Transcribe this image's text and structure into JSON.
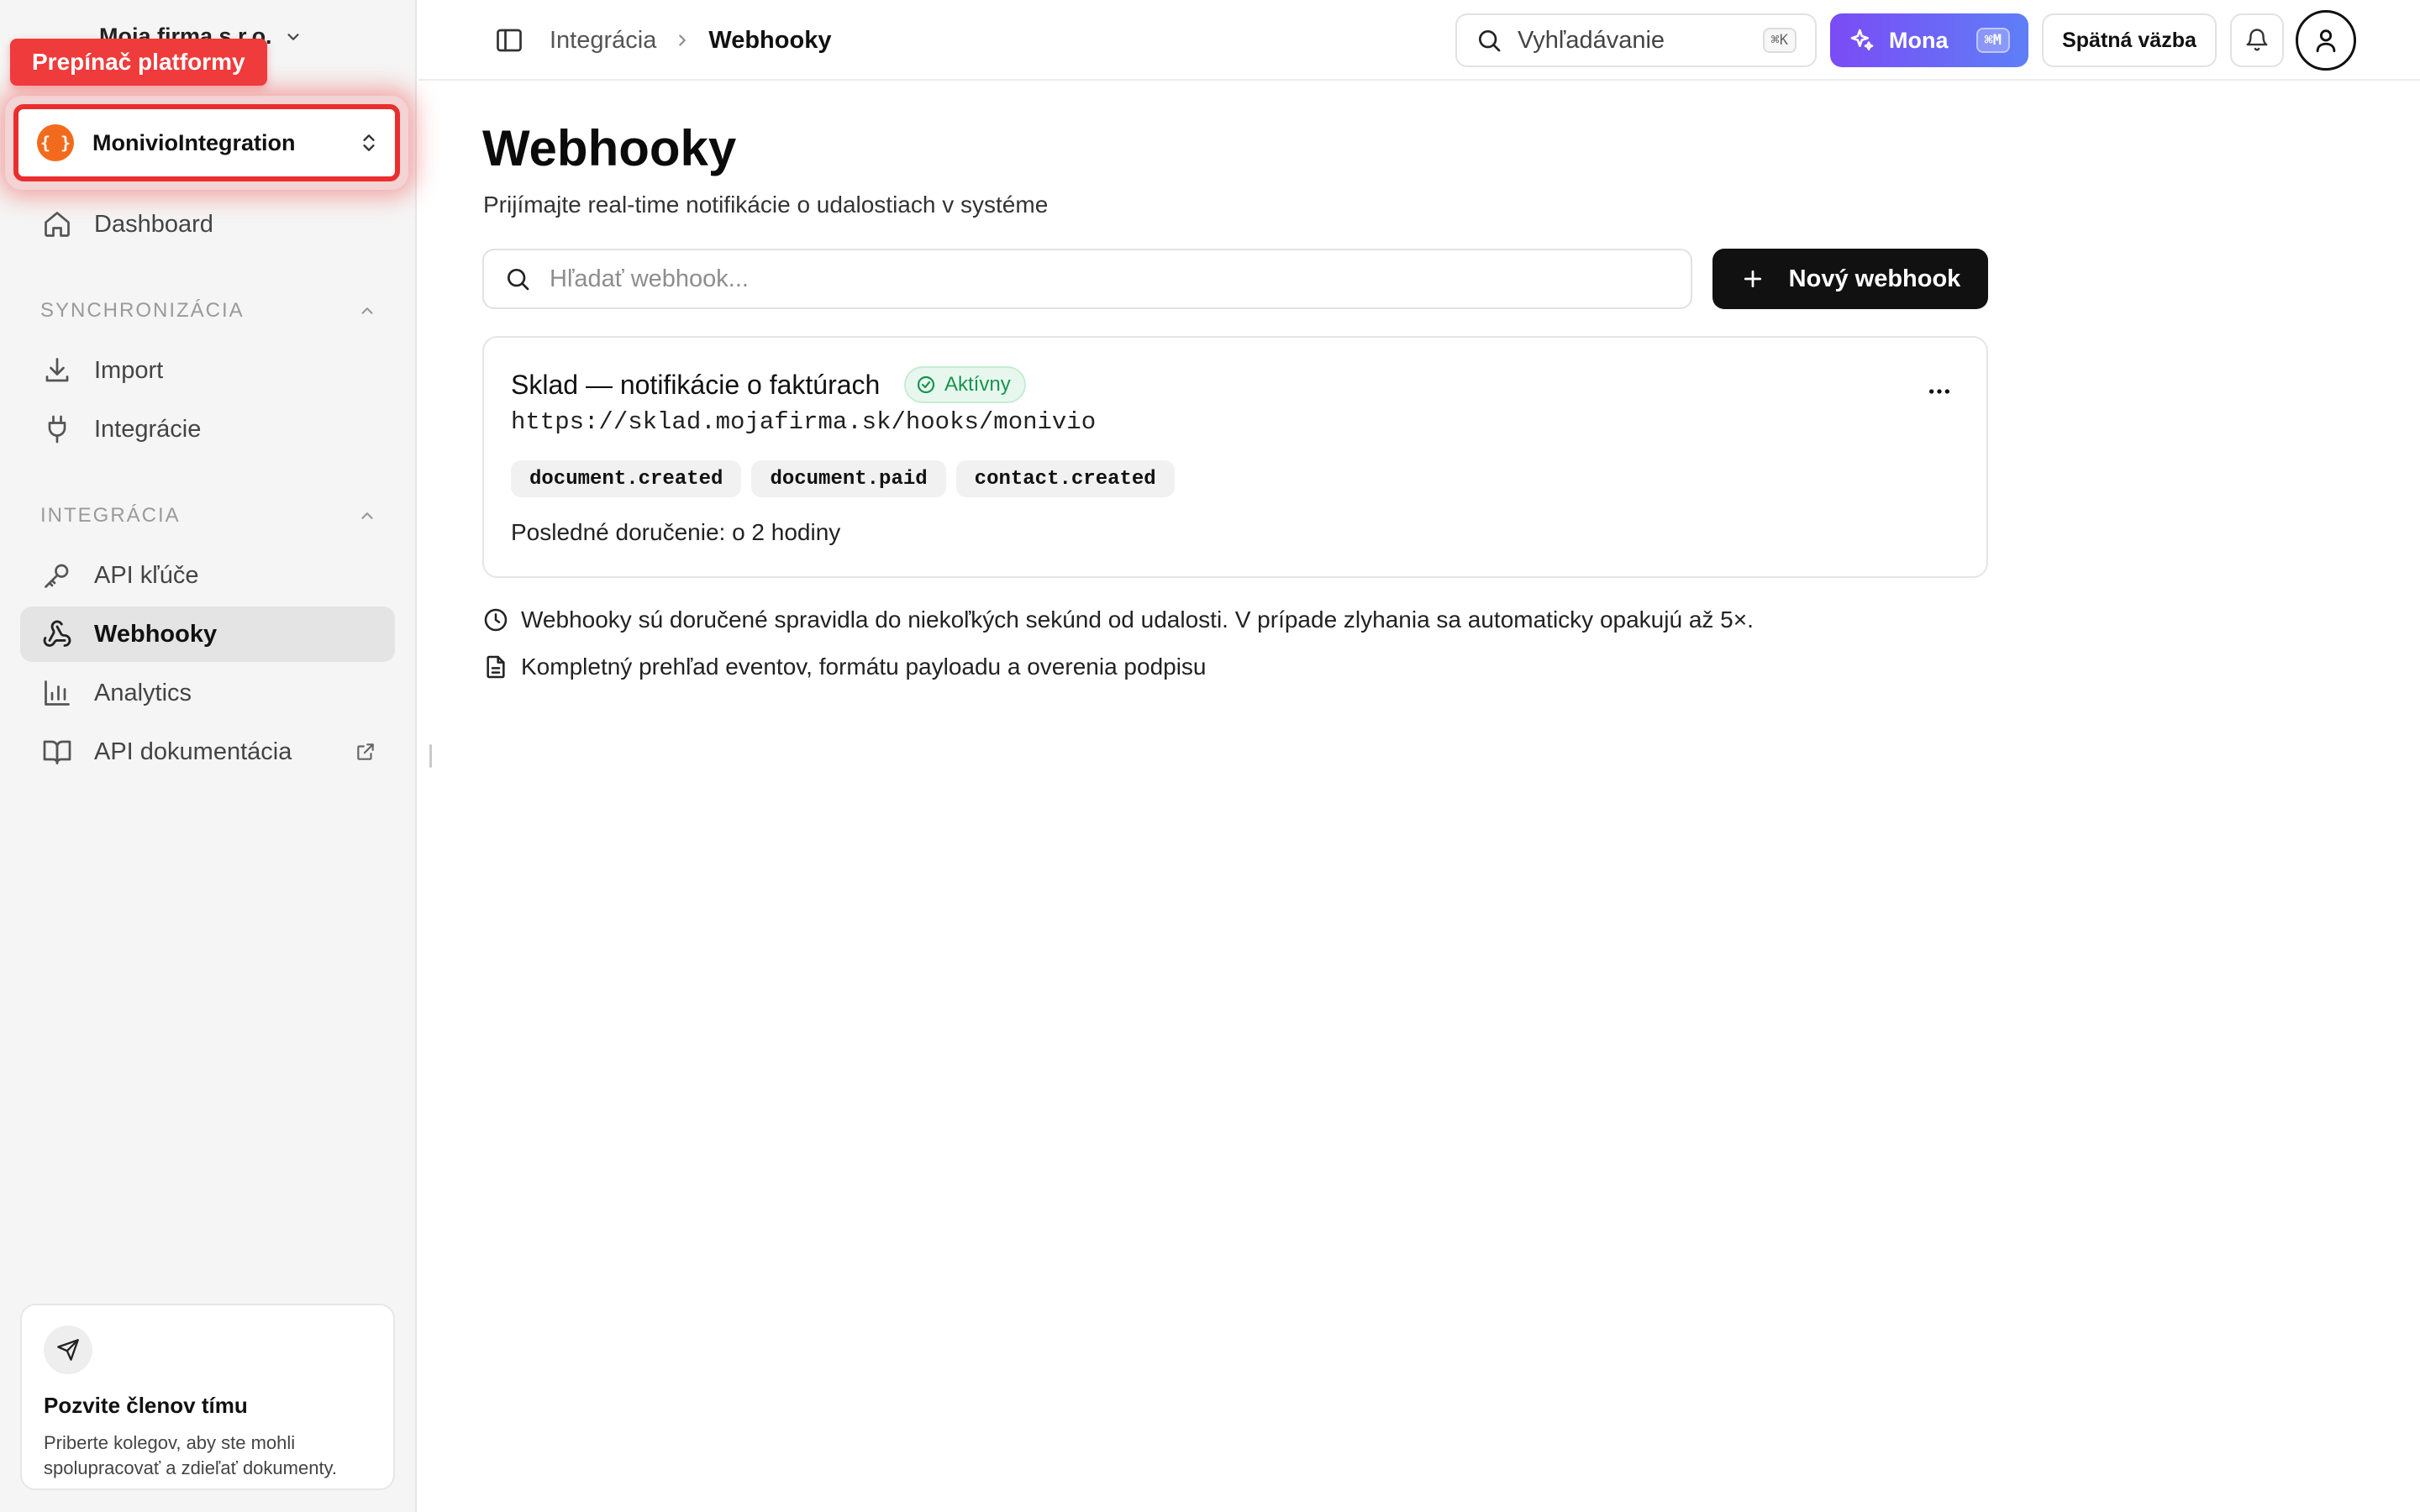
{
  "sidebar": {
    "org_name": "Moja firma s.r.o.",
    "tooltip": "Prepínač platformy",
    "platform": {
      "logo": "{ }",
      "name": "MonivioIntegration"
    },
    "dashboard": "Dashboard",
    "sections": [
      {
        "title": "SYNCHRONIZÁCIA",
        "items": [
          "Import",
          "Integrácie"
        ]
      },
      {
        "title": "INTEGRÁCIA",
        "items": [
          "API kľúče",
          "Webhooky",
          "Analytics",
          "API dokumentácia"
        ]
      }
    ],
    "active_item": "Webhooky",
    "invite": {
      "title": "Pozvite členov tímu",
      "text_line1": "Priberte kolegov, aby ste mohli",
      "text_line2": "spolupracovať a zdieľať dokumenty."
    }
  },
  "topbar": {
    "breadcrumb": [
      "Integrácia",
      "Webhooky"
    ],
    "search": {
      "label": "Vyhľadávanie",
      "shortcut": "⌘K"
    },
    "mona": {
      "label": "Mona",
      "shortcut": "⌘M"
    },
    "feedback": "Spätná väzba"
  },
  "main": {
    "title": "Webhooky",
    "subtitle": "Prijímajte real-time notifikácie o udalostiach v systéme",
    "search_placeholder": "Hľadať webhook...",
    "new_button": "Nový webhook",
    "webhooks": [
      {
        "name": "Sklad — notifikácie o faktúrach",
        "status": "Aktívny",
        "url": "https://sklad.mojafirma.sk/hooks/monivio",
        "events": [
          "document.created",
          "document.paid",
          "contact.created"
        ],
        "last_delivery": "Posledné doručenie: o 2 hodiny"
      }
    ],
    "info": [
      "Webhooky sú doručené spravidla do niekoľkých sekúnd od udalosti. V prípade zlyhania sa automaticky opakujú až 5×.",
      "Kompletný prehľad eventov, formátu payloadu a overenia podpisu"
    ]
  },
  "colors": {
    "accent_red": "#ef3b3b",
    "platform_logo": "#f26b1d",
    "status_green": "#179451",
    "mona_gradient_start": "#7b4bf5",
    "mona_gradient_end": "#5e7ff7"
  }
}
